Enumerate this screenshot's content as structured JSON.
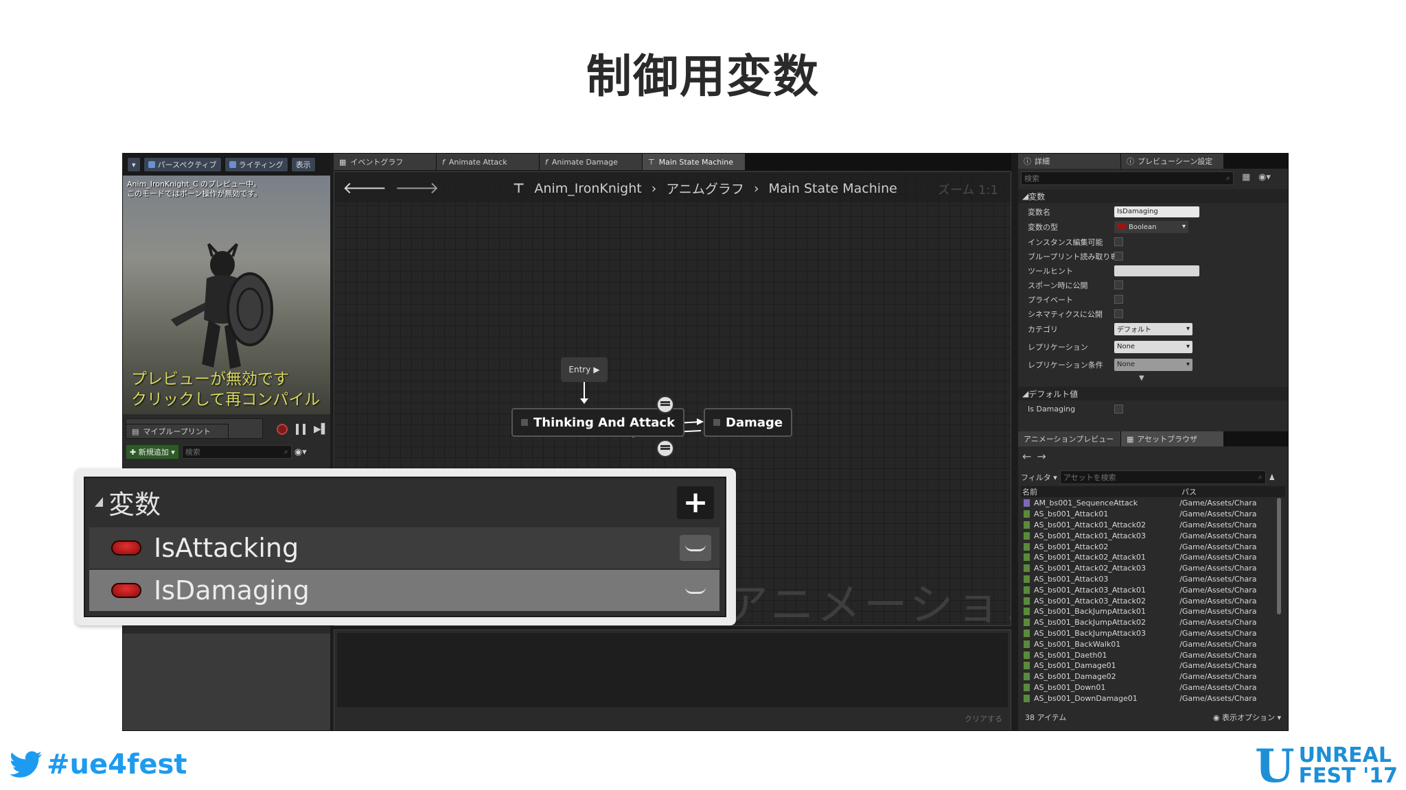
{
  "slide": {
    "title": "制御用変数",
    "hashtag": "#ue4fest",
    "logo_line1": "UNREAL",
    "logo_line2": "FEST '17"
  },
  "viewport": {
    "toolbar": [
      "パースペクティブ",
      "ライティング",
      "表示"
    ],
    "info": [
      "Anim_IronKnight_C のプレビュー中。",
      "このモードではボーン操作が無効です。"
    ],
    "warning": [
      "プレビューが無効です",
      "クリックして再コンパイル"
    ]
  },
  "my_blueprint": {
    "tab": "マイブループリント",
    "add_button": "✚ 新規追加 ▾",
    "search_placeholder": "検索"
  },
  "graph_tabs": [
    "イベントグラフ",
    "Animate Attack",
    "Animate Damage",
    "Main State Machine"
  ],
  "breadcrumb": [
    "Anim_IronKnight",
    "アニムグラフ",
    "Main State Machine"
  ],
  "zoom_label": "ズーム 1:1",
  "graph_watermark": "アニメーション",
  "nodes": {
    "entry": "Entry",
    "state1": "Thinking And Attack",
    "state2": "Damage"
  },
  "log_clear": "クリアする",
  "details": {
    "tabs": [
      "詳細",
      "プレビューシーン設定"
    ],
    "search_placeholder": "検索",
    "section_variable": "変数",
    "rows": [
      {
        "label": "変数名",
        "value": "IsDamaging"
      },
      {
        "label": "変数の型",
        "value": "Boolean"
      },
      {
        "label": "インスタンス編集可能"
      },
      {
        "label": "ブループリント読み取り専用"
      },
      {
        "label": "ツールヒント"
      },
      {
        "label": "スポーン時に公開"
      },
      {
        "label": "プライベート"
      },
      {
        "label": "シネマティクスに公開"
      },
      {
        "label": "カテゴリ",
        "value": "デフォルト"
      },
      {
        "label": "レプリケーション",
        "value": "None"
      },
      {
        "label": "レプリケーション条件",
        "value": "None"
      }
    ],
    "section_default": "デフォルト値",
    "default_row": "Is Damaging"
  },
  "asset_browser": {
    "tabs": [
      "アニメーションプレビュー",
      "アセットブラウザ"
    ],
    "filter": "フィルタ ▾",
    "search_placeholder": "アセットを検索",
    "col_name": "名前",
    "col_path": "パス",
    "items": [
      {
        "name": "AM_bs001_SequenceAttack",
        "path": "/Game/Assets/Chara"
      },
      {
        "name": "AS_bs001_Attack01",
        "path": "/Game/Assets/Chara"
      },
      {
        "name": "AS_bs001_Attack01_Attack02",
        "path": "/Game/Assets/Chara"
      },
      {
        "name": "AS_bs001_Attack01_Attack03",
        "path": "/Game/Assets/Chara"
      },
      {
        "name": "AS_bs001_Attack02",
        "path": "/Game/Assets/Chara"
      },
      {
        "name": "AS_bs001_Attack02_Attack01",
        "path": "/Game/Assets/Chara"
      },
      {
        "name": "AS_bs001_Attack02_Attack03",
        "path": "/Game/Assets/Chara"
      },
      {
        "name": "AS_bs001_Attack03",
        "path": "/Game/Assets/Chara"
      },
      {
        "name": "AS_bs001_Attack03_Attack01",
        "path": "/Game/Assets/Chara"
      },
      {
        "name": "AS_bs001_Attack03_Attack02",
        "path": "/Game/Assets/Chara"
      },
      {
        "name": "AS_bs001_BackJumpAttack01",
        "path": "/Game/Assets/Chara"
      },
      {
        "name": "AS_bs001_BackJumpAttack02",
        "path": "/Game/Assets/Chara"
      },
      {
        "name": "AS_bs001_BackJumpAttack03",
        "path": "/Game/Assets/Chara"
      },
      {
        "name": "AS_bs001_BackWalk01",
        "path": "/Game/Assets/Chara"
      },
      {
        "name": "AS_bs001_Daeth01",
        "path": "/Game/Assets/Chara"
      },
      {
        "name": "AS_bs001_Damage01",
        "path": "/Game/Assets/Chara"
      },
      {
        "name": "AS_bs001_Damage02",
        "path": "/Game/Assets/Chara"
      },
      {
        "name": "AS_bs001_Down01",
        "path": "/Game/Assets/Chara"
      },
      {
        "name": "AS_bs001_DownDamage01",
        "path": "/Game/Assets/Chara"
      }
    ],
    "count": "38 アイテム",
    "view_options": "表示オプション ▾"
  },
  "callout": {
    "section": "変数",
    "plus": "+",
    "vars": [
      "IsAttacking",
      "IsDamaging"
    ]
  }
}
